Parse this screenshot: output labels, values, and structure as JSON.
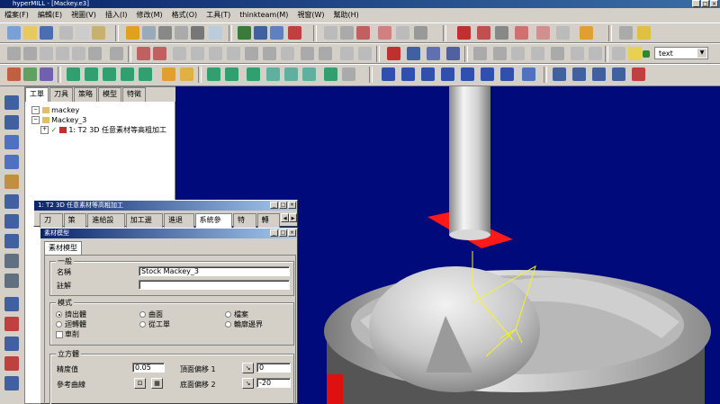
{
  "window": {
    "title": "hyperMILL - [Mackey.e3]"
  },
  "menu": [
    "檔案(F)",
    "編輯(E)",
    "視圖(V)",
    "插入(I)",
    "修改(M)",
    "格式(O)",
    "工具(T)",
    "thinkteam(M)",
    "視窗(W)",
    "幫助(H)"
  ],
  "toolbar": {
    "text_combo": "text"
  },
  "explorer": {
    "tabs": [
      "工單",
      "刀具",
      "策略",
      "模型",
      "特徵"
    ],
    "tree": [
      "mackey",
      "Mackey_3",
      "1: T2 3D 任意素材等高粗加工"
    ]
  },
  "dialog": {
    "title": "1: T2 3D 任意素材等高粗加工",
    "tabs": [
      "刀具",
      "策略",
      "進給設定",
      "加工邊界",
      "進退刀",
      "系統參數",
      "特徵",
      "轉換"
    ]
  },
  "stock": {
    "title": "素材模型",
    "tab": "素材模型",
    "general": {
      "legend": "一般",
      "name_label": "名稱",
      "name_value": "Stock Mackey_3",
      "comment_label": "註解",
      "comment_value": ""
    },
    "mode": {
      "legend": "模式",
      "options": [
        "擠出體",
        "迴轉體",
        "車削",
        "曲面",
        "從工單",
        "檔案",
        "輪廓邊界"
      ],
      "selected": "擠出體"
    },
    "cube": {
      "legend": "立方體",
      "precision_label": "精度值",
      "precision_value": "0.05",
      "ref_curve_label": "參考曲線",
      "top_offset_label": "頂面偏移 1",
      "top_offset_value": "0",
      "bottom_offset_label": "底面偏移 2",
      "bottom_offset_value": "-20"
    }
  }
}
